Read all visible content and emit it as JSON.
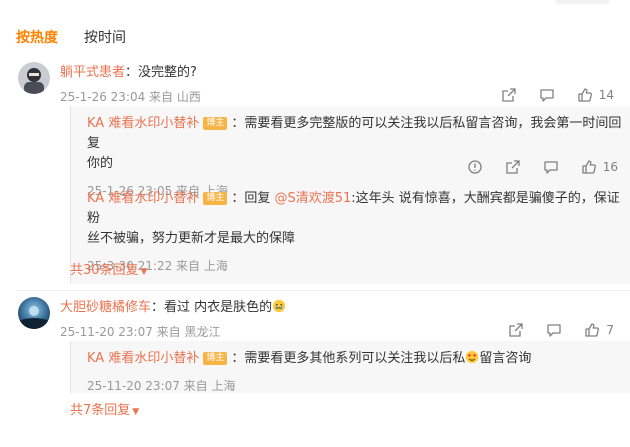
{
  "tabs": {
    "hot": "按热度",
    "time": "按时间"
  },
  "comments": [
    {
      "user": "躺平式患者",
      "text": "：没完整的?",
      "meta": "25-1-26 23:04 来自 山西",
      "likes": "14",
      "replies": [
        {
          "user": "KA 难看水印小替补",
          "badge": "博主",
          "text1": "：需要看更多完整版的可以关注我以后私留言咨询，我会第一时间回复",
          "text2": "你的",
          "meta": "25-1-26 23:05 来自 上海",
          "likes": "16"
        },
        {
          "user": "KA 难看水印小替补",
          "badge": "博主",
          "prefix": "：回复 ",
          "mention": "@S清欢渡51",
          "text1": ":这年头 说有惊喜，大酬宾都是骗傻子的，保证粉",
          "text2": "丝不被骗，努力更新才是最大的保障",
          "meta": "25-3-30 21:22 来自 上海"
        }
      ],
      "more": "共30条回复"
    },
    {
      "user": "大胆砂糖橘修车",
      "text": "：看过 内衣是肤色的",
      "meta": "25-11-20 23:07 来自 黑龙江",
      "likes": "7",
      "replies": [
        {
          "user": "KA 难看水印小替补",
          "badge": "博主",
          "text1": "：需要看更多其他系列可以关注我以后私",
          "text2": "留言咨询",
          "meta": "25-11-20 23:07 来自 上海"
        }
      ],
      "more": "共7条回复"
    }
  ],
  "colors": {
    "accent": "#ff8200",
    "username": "#eb7350",
    "meta": "#999999",
    "badge": "#f7b548",
    "reply_bg": "#f7f7f7"
  }
}
